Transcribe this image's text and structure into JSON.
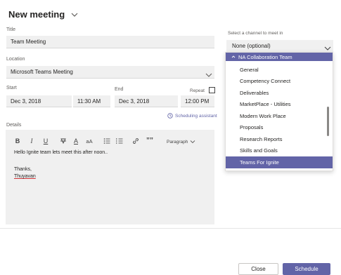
{
  "header": {
    "title": "New meeting"
  },
  "form": {
    "title_label": "Title",
    "title_value": "Team Meeting",
    "location_label": "Location",
    "location_value": "Microsoft Teams Meeting",
    "start_label": "Start",
    "start_date": "Dec 3, 2018",
    "start_time": "11:30 AM",
    "end_label": "End",
    "end_date": "Dec 3, 2018",
    "end_time": "12:00 PM",
    "repeat_label": "Repeat",
    "scheduling_assistant": "Scheduling assistant",
    "details_label": "Details"
  },
  "toolbar": {
    "bold": "B",
    "italic": "I",
    "underline": "U",
    "font_color": "A",
    "font_size": "aA",
    "quote": "””",
    "paragraph": "Paragraph"
  },
  "editor": {
    "line1": "Hello Ignite team lets meet this after noon..",
    "line2": "Thanks,",
    "line3": "Thuyavan"
  },
  "channel": {
    "label": "Select a channel to meet in",
    "value": "None (optional)",
    "group": "NA Collaboration Team",
    "items": [
      "General",
      "Competency Connect",
      "Deliverables",
      "MarketPlace - Utilities",
      "Modern Work Place",
      "Proposals",
      "Research Reports",
      "Skills and Goals",
      "Teams For Ignite"
    ]
  },
  "footer": {
    "close": "Close",
    "schedule": "Schedule"
  },
  "colors": {
    "accent": "#6264a7",
    "field_bg": "#f0f0f0"
  }
}
